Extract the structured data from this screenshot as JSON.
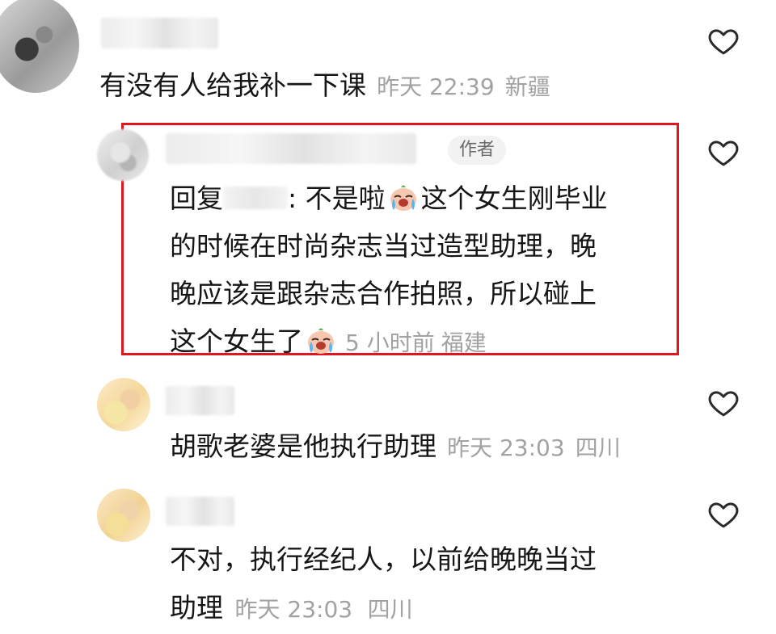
{
  "comments": [
    {
      "text": "有没有人给我补一下课",
      "time": "昨天 22:39",
      "location": "新疆"
    },
    {
      "badge": "作者",
      "reply_prefix": "回复",
      "reply_suffix": ": 不是啦",
      "line1_tail": "这个女生刚毕业",
      "line2": "的时候在时尚杂志当过造型助理，晚",
      "line3": "晚应该是跟杂志合作拍照，所以碰上",
      "line4": "这个女生了",
      "time": "5 小时前",
      "location": "福建",
      "emoji": "crying-face-emoji"
    },
    {
      "text": "胡歌老婆是他执行助理",
      "time": "昨天 23:03",
      "location": "四川"
    },
    {
      "line1": "不对，执行经纪人，以前给晚晚当过",
      "line2": "助理",
      "time": "昨天 23:03",
      "location": "四川"
    }
  ],
  "colors": {
    "highlight_border": "#e0161f",
    "meta_text": "#a2a2a2",
    "body_text": "#161616"
  },
  "icons": {
    "like": "heart-outline-icon"
  }
}
